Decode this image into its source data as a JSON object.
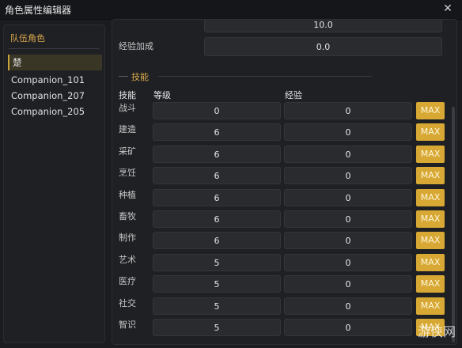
{
  "window": {
    "title": "角色属性编辑器",
    "close_glyph": "✕"
  },
  "sidebar": {
    "title": "队伍角色",
    "members": [
      {
        "name": "楚",
        "selected": true
      },
      {
        "name": "Companion_101",
        "selected": false
      },
      {
        "name": "Companion_207",
        "selected": false
      },
      {
        "name": "Companion_205",
        "selected": false
      }
    ]
  },
  "main": {
    "top_fields": [
      {
        "label": "",
        "value": "10.0"
      },
      {
        "label": "经验加成",
        "value": "0.0"
      }
    ],
    "skills_section": {
      "title": "技能",
      "headers": [
        "技能",
        "等级",
        "经验"
      ],
      "max_label": "MAX",
      "rows": [
        {
          "skill": "战斗",
          "level": "0",
          "exp": "0"
        },
        {
          "skill": "建造",
          "level": "6",
          "exp": "0"
        },
        {
          "skill": "采矿",
          "level": "6",
          "exp": "0"
        },
        {
          "skill": "烹饪",
          "level": "6",
          "exp": "0"
        },
        {
          "skill": "种植",
          "level": "6",
          "exp": "0"
        },
        {
          "skill": "畜牧",
          "level": "6",
          "exp": "0"
        },
        {
          "skill": "制作",
          "level": "6",
          "exp": "0"
        },
        {
          "skill": "艺术",
          "level": "5",
          "exp": "0"
        },
        {
          "skill": "医疗",
          "level": "5",
          "exp": "0"
        },
        {
          "skill": "社交",
          "level": "5",
          "exp": "0"
        },
        {
          "skill": "智识",
          "level": "5",
          "exp": "0"
        }
      ]
    }
  },
  "watermark": "游侠网",
  "colors": {
    "accent": "#d7a833",
    "background": "#1b1c1f",
    "panel": "#1f2024"
  },
  "icons": {
    "close": "close-icon"
  }
}
